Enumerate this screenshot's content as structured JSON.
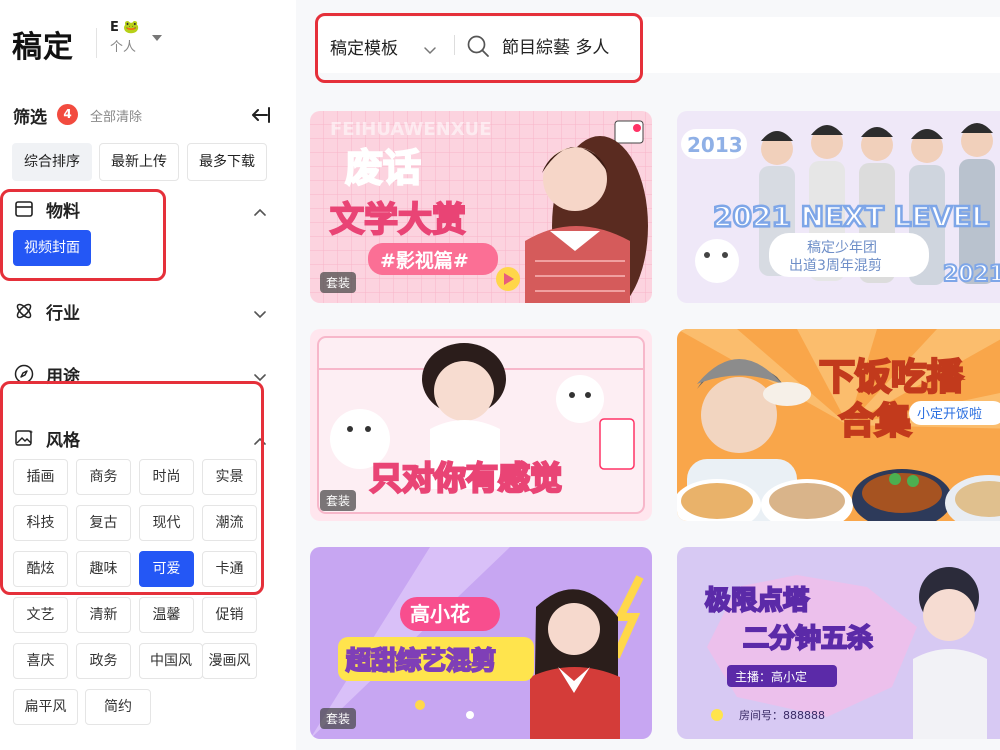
{
  "brand": {
    "logo_text": "稿定"
  },
  "workspace": {
    "name": "E 🐸",
    "type": "个人"
  },
  "search": {
    "scope": "稿定模板",
    "query": "節目綜藝 多人"
  },
  "filter": {
    "title": "筛选",
    "count": "4",
    "clear_label": "全部清除",
    "sort_options": [
      "综合排序",
      "最新上传",
      "最多下载"
    ]
  },
  "sections": {
    "material": {
      "label": "物料",
      "tags": [
        "视频封面"
      ]
    },
    "industry": {
      "label": "行业"
    },
    "usage": {
      "label": "用途"
    },
    "style": {
      "label": "风格",
      "tags": [
        "插画",
        "商务",
        "时尚",
        "实景",
        "科技",
        "复古",
        "现代",
        "潮流",
        "酷炫",
        "趣味",
        "可爱",
        "卡通",
        "文艺",
        "清新",
        "温馨",
        "促销",
        "喜庆",
        "政务",
        "中国风",
        "漫画风",
        "扁平风",
        "简约"
      ]
    }
  },
  "cards": [
    {
      "lines": [
        "废话",
        "文学大赏",
        "#影视篇#"
      ],
      "watermark": "FEIHUAWENXUE",
      "badge": "套装"
    },
    {
      "lines": [
        "2021 NEXT LEVEL",
        "稿定少年团",
        "出道3周年混剪"
      ],
      "years": [
        "2013",
        "2021"
      ]
    },
    {
      "lines": [
        "只对你有感觉"
      ],
      "badge": "套装"
    },
    {
      "lines": [
        "下饭吃播",
        "合集",
        "小定开饭啦"
      ]
    },
    {
      "lines": [
        "高小花",
        "超甜综艺混剪"
      ],
      "badge": "套装"
    },
    {
      "lines": [
        "极限点塔",
        "二分钟五杀",
        "主播：高小定",
        "房间号：888888"
      ]
    }
  ],
  "colors": {
    "accent": "#2457f5",
    "badge": "#f24b3f",
    "highlight": "#e5303a"
  }
}
